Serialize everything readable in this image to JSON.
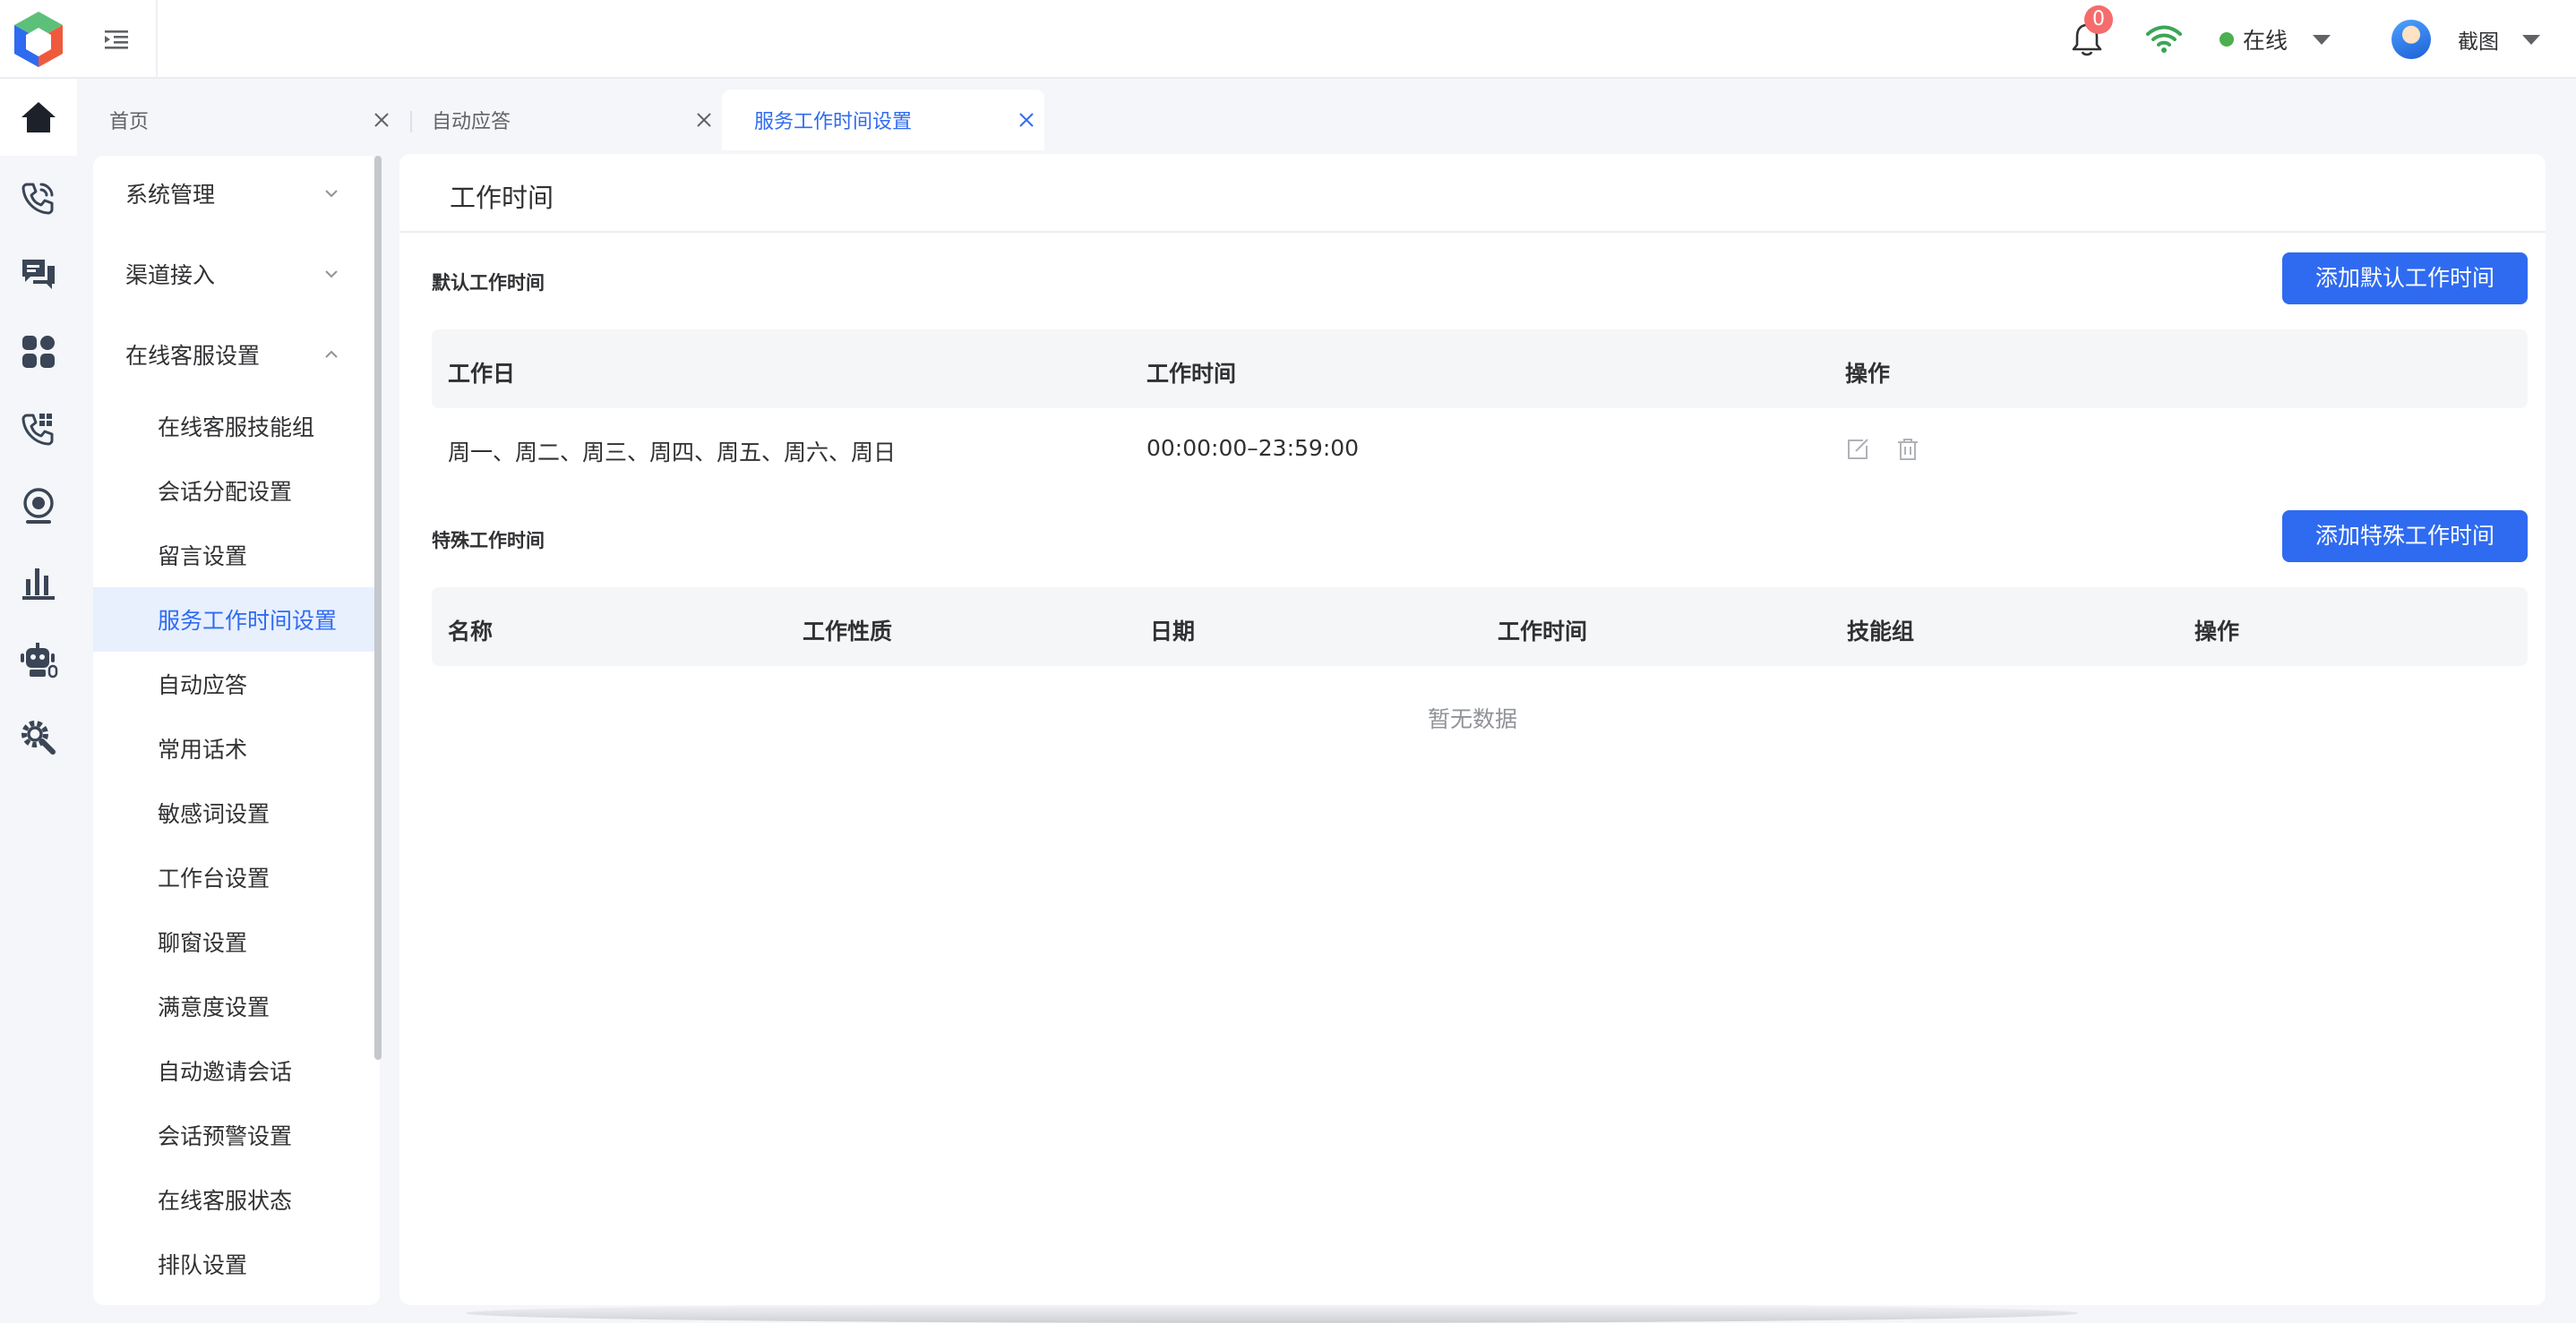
{
  "header": {
    "notification_count": "0",
    "status_label": "在线",
    "status_color": "#4caf50",
    "user_name": "截图"
  },
  "rail": {
    "icons": [
      "home-icon",
      "phone-call-icon",
      "chat-icon",
      "apps-icon",
      "phone-transfer-icon",
      "webcam-icon",
      "bar-chart-icon",
      "robot-icon",
      "settings-icon"
    ],
    "active_index": 0
  },
  "tabs": [
    {
      "label": "首页"
    },
    {
      "label": "自动应答"
    },
    {
      "label": "服务工作时间设置"
    }
  ],
  "menu": {
    "groups": [
      {
        "label": "系统管理"
      },
      {
        "label": "渠道接入"
      },
      {
        "label": "在线客服设置"
      }
    ],
    "items": [
      {
        "label": "在线客服技能组"
      },
      {
        "label": "会话分配设置"
      },
      {
        "label": "留言设置"
      },
      {
        "label": "服务工作时间设置"
      },
      {
        "label": "自动应答"
      },
      {
        "label": "常用话术"
      },
      {
        "label": "敏感词设置"
      },
      {
        "label": "工作台设置"
      },
      {
        "label": "聊窗设置"
      },
      {
        "label": "满意度设置"
      },
      {
        "label": "自动邀请会话"
      },
      {
        "label": "会话预警设置"
      },
      {
        "label": "在线客服状态"
      },
      {
        "label": "排队设置"
      }
    ],
    "active_item": "服务工作时间设置"
  },
  "main": {
    "page_title": "工作时间",
    "default_section": {
      "title": "默认工作时间",
      "add_button": "添加默认工作时间",
      "columns": [
        "工作日",
        "工作时间",
        "操作"
      ],
      "rows": [
        {
          "days": "周一、周二、周三、周四、周五、周六、周日",
          "time": "00:00:00–23:59:00"
        }
      ]
    },
    "special_section": {
      "title": "特殊工作时间",
      "add_button": "添加特殊工作时间",
      "columns": [
        "名称",
        "工作性质",
        "日期",
        "工作时间",
        "技能组",
        "操作"
      ],
      "empty_text": "暂无数据"
    }
  },
  "colors": {
    "accent": "#2f6bf0",
    "badge": "#f56c6c",
    "wifi": "#3aa655"
  }
}
